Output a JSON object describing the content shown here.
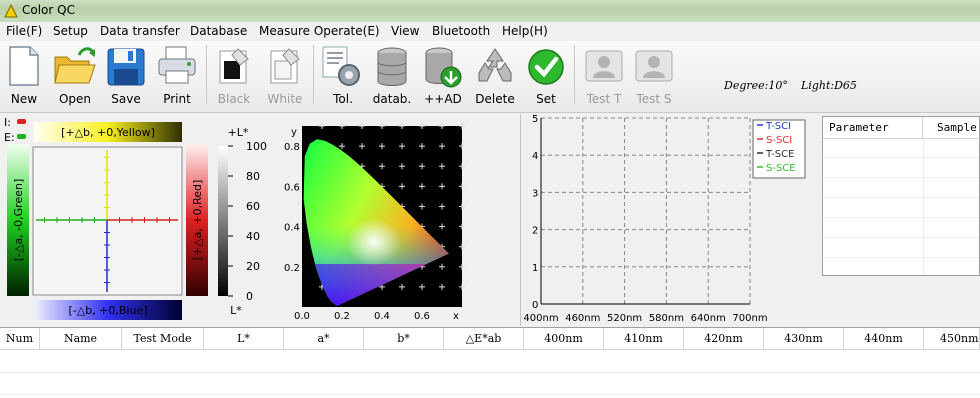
{
  "window": {
    "title": "Color QC"
  },
  "menu": [
    "File(F)",
    "Setup",
    "Data transfer",
    "Database",
    "Measure Operate(E)",
    "View",
    "Bluetooth",
    "Help(H)"
  ],
  "toolbar": {
    "new": "New",
    "open": "Open",
    "save": "Save",
    "print": "Print",
    "black": "Black",
    "white": "White",
    "tol": "Tol.",
    "datab": "datab.",
    "add": "++AD",
    "delete": "Delete",
    "set": "Set",
    "test_t": "Test T",
    "test_s": "Test S"
  },
  "status": {
    "degree": "Degree:10°",
    "light": "Light:D65"
  },
  "lab": {
    "i_label": "I:",
    "e_label": "E:",
    "plus_b": "[+△b, +0,Yellow]",
    "minus_b": "[-△b, +0,Blue]",
    "minus_a": "[-△a, -0,Green]",
    "plus_a": "[+△a, +0,Red]",
    "plus_l": "+L*",
    "l": "L*",
    "l_ticks": [
      "100",
      "80",
      "60",
      "40",
      "20",
      "0"
    ]
  },
  "cie": {
    "y_label": "y",
    "x_label": "x",
    "y_ticks": [
      "0.8",
      "0.6",
      "0.4",
      "0.2"
    ],
    "x_ticks": [
      "0.0",
      "0.2",
      "0.4",
      "0.6"
    ]
  },
  "spectrum": {
    "y_ticks": [
      "5",
      "4",
      "3",
      "2",
      "1",
      "0"
    ],
    "x_ticks": [
      "400nm",
      "460nm",
      "520nm",
      "580nm",
      "640nm",
      "700nm"
    ],
    "legend": [
      {
        "name": "T-SCI",
        "color": "#2040d0"
      },
      {
        "name": "S-SCI",
        "color": "#e03030"
      },
      {
        "name": "T-SCE",
        "color": "#303030"
      },
      {
        "name": "S-SCE",
        "color": "#30c030"
      }
    ]
  },
  "params": {
    "col1": "Parameter",
    "col2": "Sample"
  },
  "table": {
    "columns": [
      "Num",
      "Name",
      "Test Mode",
      "L*",
      "a*",
      "b*",
      "△E*ab",
      "400nm",
      "410nm",
      "420nm",
      "430nm",
      "440nm",
      "450nm"
    ]
  }
}
